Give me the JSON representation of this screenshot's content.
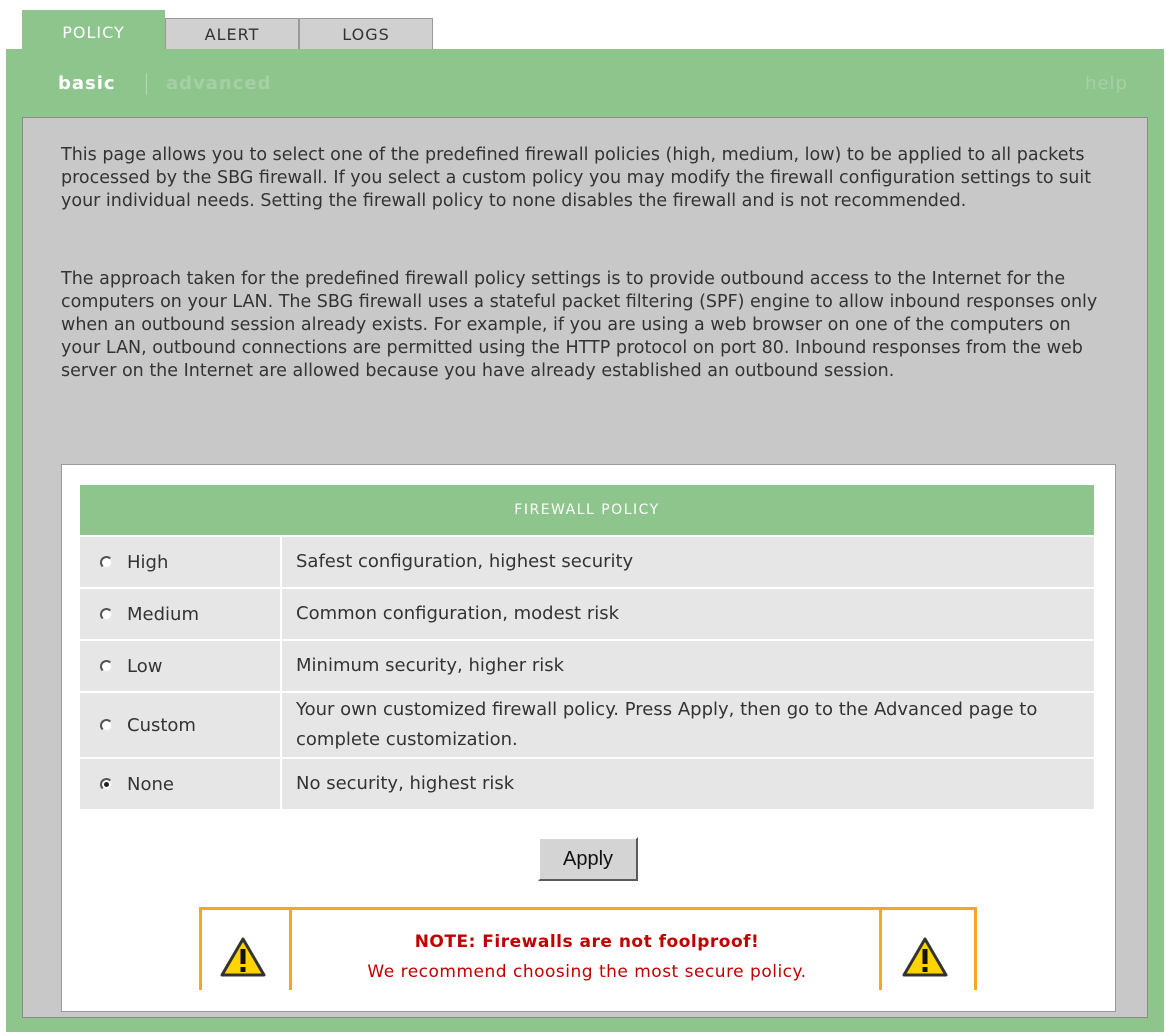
{
  "tabs": [
    {
      "label": "POLICY",
      "active": true
    },
    {
      "label": "ALERT",
      "active": false
    },
    {
      "label": "LOGS",
      "active": false
    }
  ],
  "subnav": {
    "basic": "basic",
    "advanced": "advanced",
    "help": "help"
  },
  "intro": {
    "para1": "This page allows you to select one of the predefined firewall policies (high, medium, low) to be applied to all packets processed by the SBG firewall. If you select a custom policy you may modify the firewall configuration settings to suit your individual needs. Setting the firewall policy to none disables the firewall and is not recommended.",
    "para2": "The approach taken for the predefined firewall policy settings is to provide outbound access to the Internet for the computers on your LAN. The SBG firewall uses a stateful packet filtering (SPF) engine to allow inbound responses only when an outbound session already exists. For example, if you are using a web browser on one of the computers on your LAN, outbound connections are permitted using the HTTP protocol on port 80. Inbound responses from the web server on the Internet are allowed because you have already established an outbound session."
  },
  "policy": {
    "header": "FIREWALL POLICY",
    "options": [
      {
        "label": "High",
        "description": "Safest configuration, highest security",
        "checked": false
      },
      {
        "label": "Medium",
        "description": "Common configuration, modest risk",
        "checked": false
      },
      {
        "label": "Low",
        "description": "Minimum security, higher risk",
        "checked": false
      },
      {
        "label": "Custom",
        "description": "Your own customized firewall policy. Press Apply, then go to the Advanced page to complete customization.",
        "checked": false
      },
      {
        "label": "None",
        "description": "No security, highest risk",
        "checked": true
      }
    ],
    "apply_label": "Apply"
  },
  "note": {
    "title": "NOTE: Firewalls are not foolproof!",
    "text": "We recommend choosing the most secure policy.",
    "icon": "warning-icon"
  },
  "colors": {
    "accent_green": "#8dc58d",
    "content_gray": "#c8c8c8",
    "row_gray": "#e6e6e6",
    "note_orange": "#f5a623",
    "note_red": "#c00000"
  }
}
